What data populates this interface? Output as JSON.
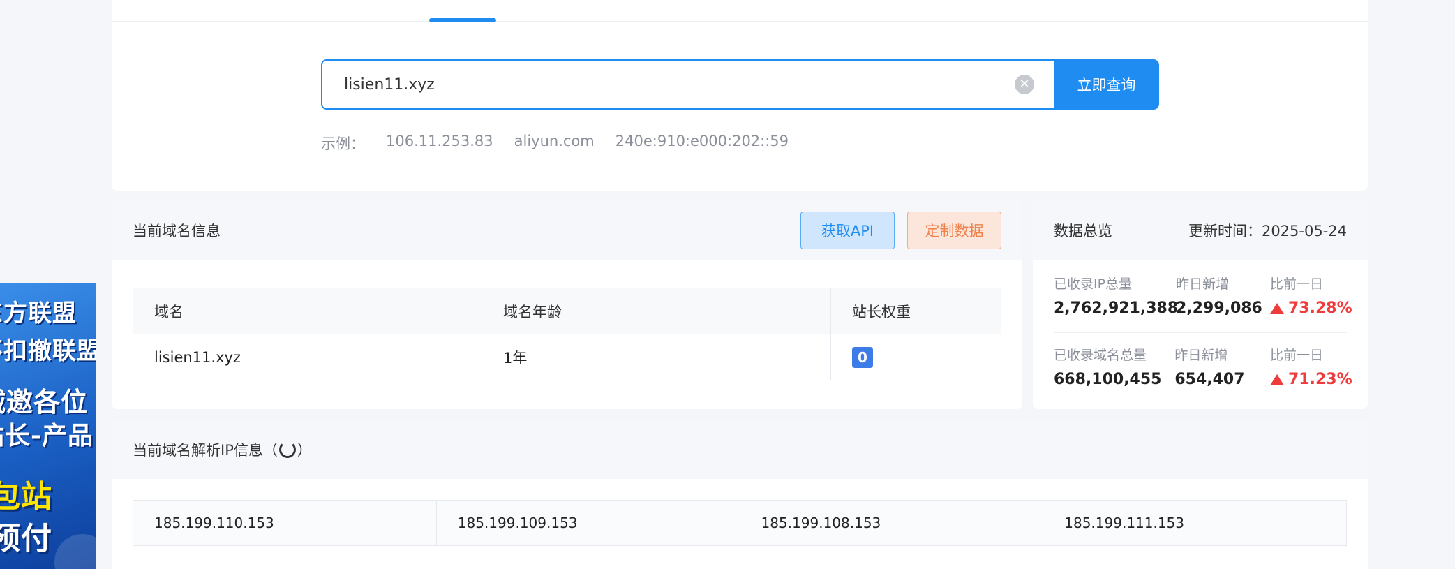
{
  "ad": {
    "lines": [
      "东方联盟",
      "不扣撤联盟",
      "诚邀各位",
      "站长-产品",
      "包站",
      "预付"
    ]
  },
  "search": {
    "value": "lisien11.xyz",
    "button_label": "立即查询",
    "examples_label": "示例：",
    "examples": [
      "106.11.253.83",
      "aliyun.com",
      "240e:910:e000:202::59"
    ]
  },
  "domain_info": {
    "title": "当前域名信息",
    "api_button": "获取API",
    "custom_button": "定制数据",
    "columns": [
      "域名",
      "域名年龄",
      "站长权重"
    ],
    "row": {
      "domain": "lisien11.xyz",
      "age": "1年",
      "weight": "0"
    }
  },
  "stats": {
    "title": "数据总览",
    "update_label": "更新时间：",
    "update_date": "2025-05-24",
    "ip": {
      "total_label": "已收录IP总量",
      "total_value": "2,762,921,388",
      "new_label": "昨日新增",
      "new_value": "2,299,086",
      "change_label": "比前一日",
      "change_value": "73.28%"
    },
    "domain": {
      "total_label": "已收录域名总量",
      "total_value": "668,100,455",
      "new_label": "昨日新增",
      "new_value": "654,407",
      "change_label": "比前一日",
      "change_value": "71.23%"
    }
  },
  "ip_info": {
    "title_prefix": "当前域名解析IP信息（",
    "title_suffix": "）",
    "ips": [
      "185.199.110.153",
      "185.199.109.153",
      "185.199.108.153",
      "185.199.111.153"
    ]
  },
  "colors": {
    "accent": "#1f8cf2",
    "up": "#ee3b3b",
    "orange": "#f0824c"
  }
}
